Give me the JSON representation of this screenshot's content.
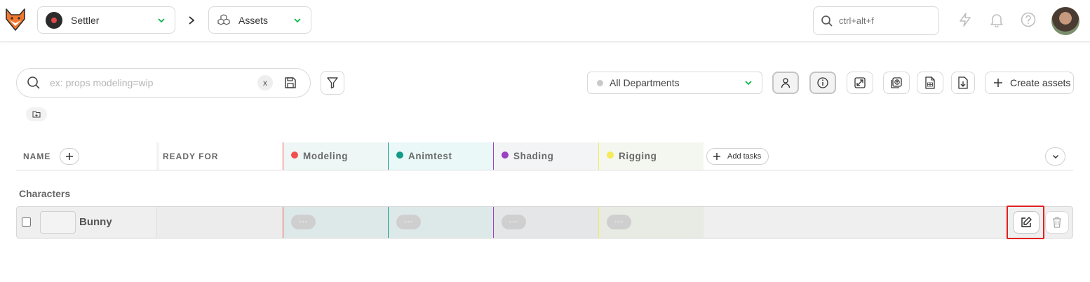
{
  "topbar": {
    "production": {
      "label": "Settler"
    },
    "section": {
      "label": "Assets"
    },
    "global_search": {
      "placeholder": "ctrl+alt+f"
    },
    "icons": [
      "fox-logo-icon",
      "chevron-down-icon",
      "chevron-right-icon",
      "cubes-icon",
      "search-icon",
      "lightning-icon",
      "bell-icon",
      "help-icon",
      "user-avatar"
    ]
  },
  "filters": {
    "search": {
      "placeholder": "ex: props modeling=wip",
      "clear_label": "x"
    },
    "department": {
      "label": "All Departments"
    },
    "create_label": "Create assets"
  },
  "table": {
    "headers": {
      "name": "NAME",
      "ready_for": "READY FOR",
      "add_tasks": "Add tasks"
    },
    "task_columns": [
      {
        "label": "Modeling",
        "color": "#f44d4d",
        "bg": "#eef7f6",
        "cell_bg": "#dde9e9"
      },
      {
        "label": "Animtest",
        "color": "#129b87",
        "bg": "#eaf8f8",
        "cell_bg": "#dde9e9"
      },
      {
        "label": "Shading",
        "color": "#9b3fc4",
        "bg": "#f3f4f5",
        "cell_bg": "#e5e6e7"
      },
      {
        "label": "Rigging",
        "color": "#f4ea5a",
        "bg": "#f4f7f0",
        "cell_bg": "#e8eae4"
      }
    ],
    "groups": [
      {
        "title": "Characters",
        "rows": [
          {
            "name": "Bunny",
            "statuses": [
              "---",
              "---",
              "---",
              "---"
            ]
          }
        ]
      }
    ]
  },
  "colors": {
    "highlight": "#e02020",
    "accent_green": "#00b242"
  }
}
